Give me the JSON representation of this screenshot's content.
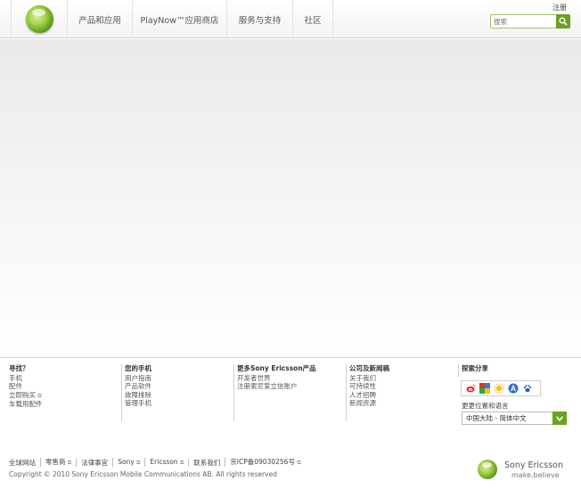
{
  "header": {
    "nav": [
      "产品和应用",
      "PlayNow™应用商店",
      "服务与支持",
      "社区"
    ],
    "register_label": "注册",
    "search": {
      "placeholder": "搜索"
    }
  },
  "footer": {
    "columns": [
      {
        "title": "寻找？",
        "links": [
          "手机",
          "配件",
          "立即购买",
          "车载用配件"
        ]
      },
      {
        "title": "您的手机",
        "links": [
          "用户指南",
          "产品软件",
          "故障排除",
          "管理手机"
        ]
      },
      {
        "title": "更多Sony Ericsson产品",
        "links": [
          "开发者世界",
          "注册索尼爱立信账户"
        ]
      },
      {
        "title": "公司及新闻稿",
        "links": [
          "关于我们",
          "可持续性",
          "人才招聘",
          "新闻资源"
        ]
      }
    ],
    "share": {
      "title": "探索分享",
      "icons": [
        "weibo-icon",
        "google-icon",
        "sun-icon",
        "a-icon",
        "paw-icon"
      ]
    },
    "region": {
      "label": "更更位置和语言",
      "selected": "中国大陆 - 简体中文"
    },
    "bottom_links": [
      "全球网站",
      "零售商",
      "法律事宜",
      "Sony",
      "Ericsson",
      "联系我们",
      "京ICP备09030256号"
    ],
    "copyright": "Copyright © 2010 Sony Ericsson Mobile Communications AB. All rights reserved",
    "brand": {
      "name": "Sony Ericsson",
      "tagline": "make.believe"
    }
  },
  "colors": {
    "accent": "#6aa21f",
    "brand_green": "#5c9a1e"
  }
}
